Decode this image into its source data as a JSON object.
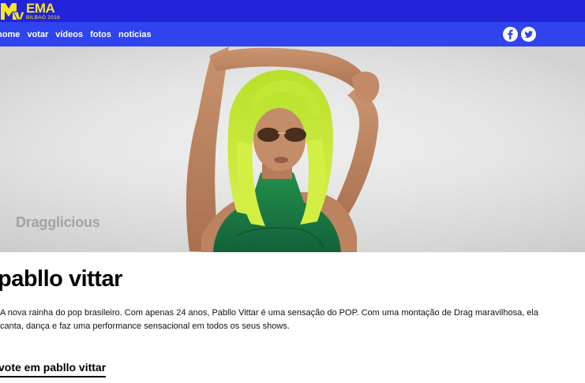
{
  "header": {
    "logo": {
      "brand": "MTV",
      "title": "EMA",
      "subtitle": "BILBAO 2018"
    },
    "nav": [
      {
        "label": "home"
      },
      {
        "label": "votar"
      },
      {
        "label": "vídeos"
      },
      {
        "label": "fotos"
      },
      {
        "label": "notícias"
      }
    ],
    "social": [
      {
        "icon": "facebook-icon"
      },
      {
        "icon": "twitter-icon"
      }
    ],
    "colors": {
      "topbar": "#2323d9",
      "navbar": "#2f43ee",
      "logo_accent": "#f7e52a"
    }
  },
  "hero": {
    "watermark": "Dragglicious",
    "hair_color": "#c8ec2a",
    "top_color": "#1f8a47"
  },
  "artist": {
    "name": "pabllo vittar",
    "description": "A nova rainha do pop brasileiro. Com apenas 24 anos, Pabllo Vittar é uma sensação do POP. Com uma montação de Drag maravilhosa, ela canta, dança e faz uma performance sensacional em todos os seus shows.",
    "vote_label": "vote em pabllo vittar"
  }
}
